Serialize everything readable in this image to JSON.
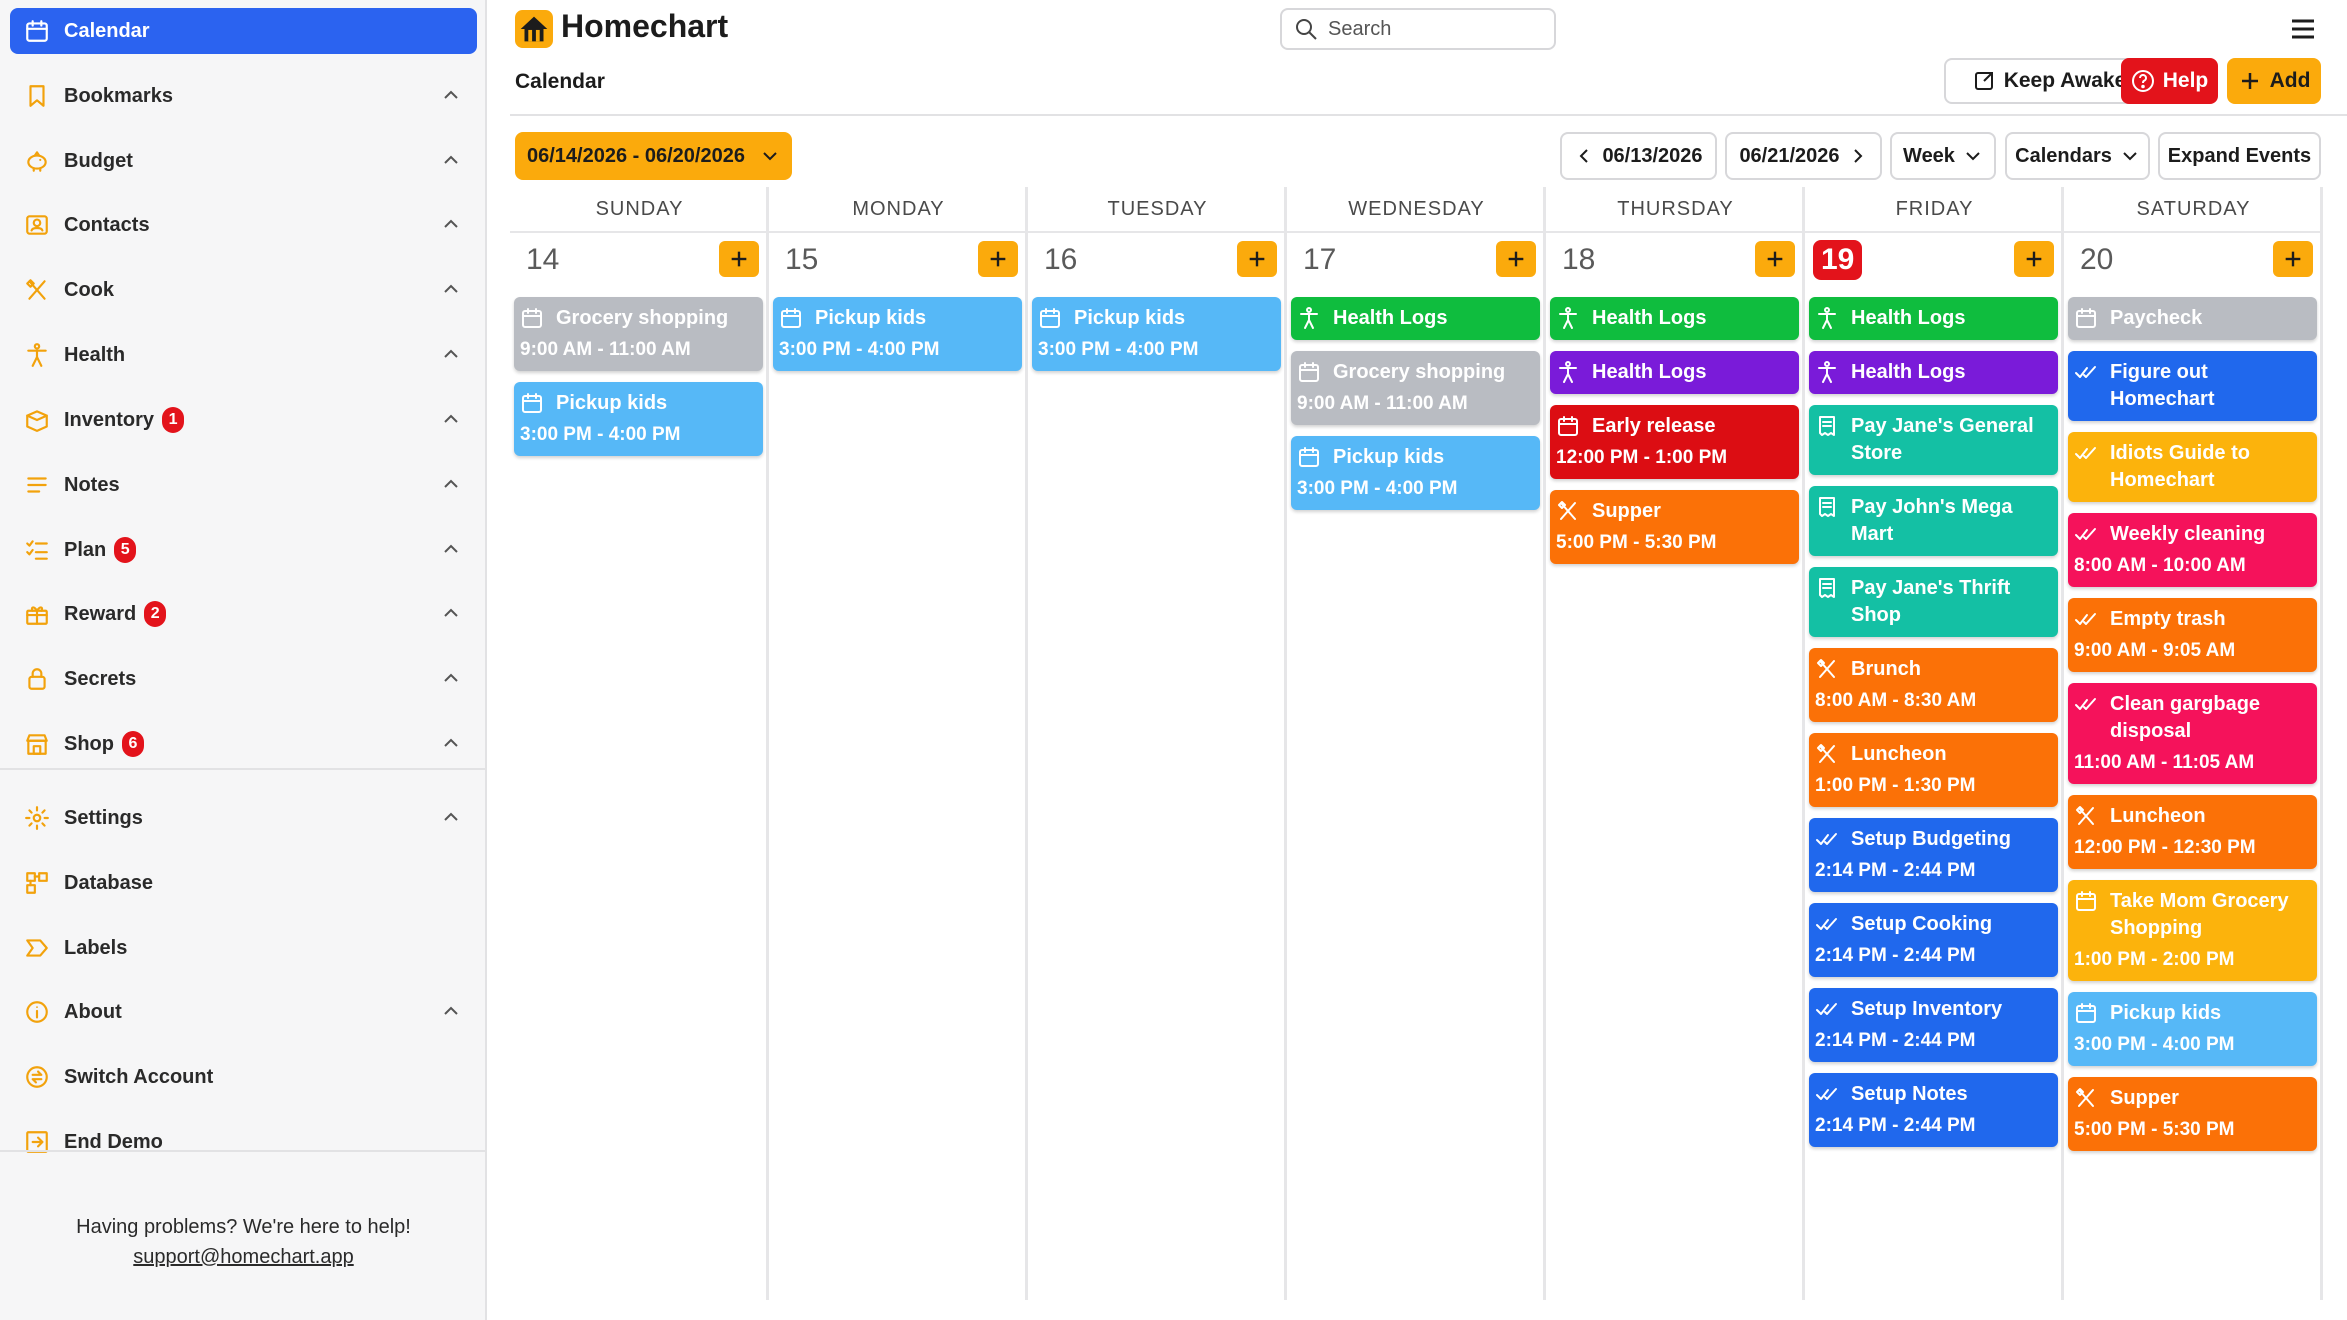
{
  "colors": {
    "accent_blue": "#2b63f0",
    "accent_orange": "#fbaa0c",
    "accent_red": "#e3131b",
    "event_gray": "#b9bcc2",
    "event_sky": "#56b8f7",
    "event_green": "#0fbd3e",
    "event_purple": "#7a1bd9",
    "event_red": "#dc0d13",
    "event_orange": "#fb7107",
    "event_teal": "#14c0a4",
    "event_blue": "#2068ed",
    "event_yellow": "#fcb30c",
    "event_pink": "#f5125b"
  },
  "app": {
    "title": "Homechart",
    "logo_icon": "house-icon"
  },
  "search": {
    "placeholder": "Search",
    "icon": "search-icon"
  },
  "page_title": "Calendar",
  "header_buttons": {
    "keep_awake": "Keep Awake",
    "help": "Help",
    "add": "Add"
  },
  "sidebar": {
    "items": [
      {
        "label": "Calendar",
        "icon": "calendar-icon",
        "active": true,
        "expandable": false,
        "badge": ""
      },
      {
        "label": "Bookmarks",
        "icon": "bookmark-icon",
        "active": false,
        "expandable": true,
        "badge": ""
      },
      {
        "label": "Budget",
        "icon": "piggy-bank-icon",
        "active": false,
        "expandable": true,
        "badge": ""
      },
      {
        "label": "Contacts",
        "icon": "contacts-icon",
        "active": false,
        "expandable": true,
        "badge": ""
      },
      {
        "label": "Cook",
        "icon": "utensils-icon",
        "active": false,
        "expandable": true,
        "badge": ""
      },
      {
        "label": "Health",
        "icon": "person-icon",
        "active": false,
        "expandable": true,
        "badge": ""
      },
      {
        "label": "Inventory",
        "icon": "box-icon",
        "active": false,
        "expandable": true,
        "badge": "1"
      },
      {
        "label": "Notes",
        "icon": "notes-icon",
        "active": false,
        "expandable": true,
        "badge": ""
      },
      {
        "label": "Plan",
        "icon": "checklist-icon",
        "active": false,
        "expandable": true,
        "badge": "5"
      },
      {
        "label": "Reward",
        "icon": "gift-icon",
        "active": false,
        "expandable": true,
        "badge": "2"
      },
      {
        "label": "Secrets",
        "icon": "lock-icon",
        "active": false,
        "expandable": true,
        "badge": ""
      },
      {
        "label": "Shop",
        "icon": "store-icon",
        "active": false,
        "expandable": true,
        "badge": "6"
      },
      {
        "label": "Settings",
        "icon": "gear-icon",
        "active": false,
        "expandable": true,
        "badge": ""
      },
      {
        "label": "Database",
        "icon": "database-icon",
        "active": false,
        "expandable": false,
        "badge": ""
      },
      {
        "label": "Labels",
        "icon": "label-icon",
        "active": false,
        "expandable": false,
        "badge": ""
      },
      {
        "label": "About",
        "icon": "info-icon",
        "active": false,
        "expandable": true,
        "badge": ""
      },
      {
        "label": "Switch Account",
        "icon": "switch-account-icon",
        "active": false,
        "expandable": false,
        "badge": ""
      },
      {
        "label": "End Demo",
        "icon": "exit-icon",
        "active": false,
        "expandable": false,
        "badge": ""
      }
    ],
    "help_text": "Having problems? We're here to help!",
    "support_email": "support@homechart.app"
  },
  "toolbar": {
    "date_range": "06/14/2026 - 06/20/2026",
    "prev_week": "06/13/2026",
    "next_week": "06/21/2026",
    "view": "Week",
    "calendars": "Calendars",
    "expand": "Expand Events"
  },
  "week": {
    "days": [
      {
        "name": "SUNDAY",
        "number": "14",
        "today": false,
        "events": [
          {
            "title": "Grocery shopping",
            "time": "9:00 AM - 11:00 AM",
            "color": "#b9bcc2",
            "icon": "calendar-icon",
            "lines": 1
          },
          {
            "title": "Pickup kids",
            "time": "3:00 PM - 4:00 PM",
            "color": "#56b8f7",
            "icon": "calendar-icon",
            "lines": 1
          }
        ]
      },
      {
        "name": "MONDAY",
        "number": "15",
        "today": false,
        "events": [
          {
            "title": "Pickup kids",
            "time": "3:00 PM - 4:00 PM",
            "color": "#56b8f7",
            "icon": "calendar-icon",
            "lines": 1
          }
        ]
      },
      {
        "name": "TUESDAY",
        "number": "16",
        "today": false,
        "events": [
          {
            "title": "Pickup kids",
            "time": "3:00 PM - 4:00 PM",
            "color": "#56b8f7",
            "icon": "calendar-icon",
            "lines": 1
          }
        ]
      },
      {
        "name": "WEDNESDAY",
        "number": "17",
        "today": false,
        "events": [
          {
            "title": "Health Logs",
            "time": "",
            "color": "#0fbd3e",
            "icon": "person-icon",
            "lines": 1
          },
          {
            "title": "Grocery shopping",
            "time": "9:00 AM - 11:00 AM",
            "color": "#b9bcc2",
            "icon": "calendar-icon",
            "lines": 1
          },
          {
            "title": "Pickup kids",
            "time": "3:00 PM - 4:00 PM",
            "color": "#56b8f7",
            "icon": "calendar-icon",
            "lines": 1
          }
        ]
      },
      {
        "name": "THURSDAY",
        "number": "18",
        "today": false,
        "events": [
          {
            "title": "Health Logs",
            "time": "",
            "color": "#0fbd3e",
            "icon": "person-icon",
            "lines": 1
          },
          {
            "title": "Health Logs",
            "time": "",
            "color": "#7a1bd9",
            "icon": "person-icon",
            "lines": 1
          },
          {
            "title": "Early release",
            "time": "12:00 PM - 1:00 PM",
            "color": "#dc0d13",
            "icon": "calendar-icon",
            "lines": 1
          },
          {
            "title": "Supper",
            "time": "5:00 PM - 5:30 PM",
            "color": "#fb7107",
            "icon": "utensils-icon",
            "lines": 1
          }
        ]
      },
      {
        "name": "FRIDAY",
        "number": "19",
        "today": true,
        "events": [
          {
            "title": "Health Logs",
            "time": "",
            "color": "#0fbd3e",
            "icon": "person-icon",
            "lines": 1
          },
          {
            "title": "Health Logs",
            "time": "",
            "color": "#7a1bd9",
            "icon": "person-icon",
            "lines": 1
          },
          {
            "title": "Pay Jane's General Store",
            "time": "",
            "color": "#14c0a4",
            "icon": "receipt-icon",
            "lines": 2
          },
          {
            "title": "Pay John's Mega Mart",
            "time": "",
            "color": "#14c0a4",
            "icon": "receipt-icon",
            "lines": 2
          },
          {
            "title": "Pay Jane's Thrift Shop",
            "time": "",
            "color": "#14c0a4",
            "icon": "receipt-icon",
            "lines": 2
          },
          {
            "title": "Brunch",
            "time": "8:00 AM - 8:30 AM",
            "color": "#fb7107",
            "icon": "utensils-icon",
            "lines": 1
          },
          {
            "title": "Luncheon",
            "time": "1:00 PM - 1:30 PM",
            "color": "#fb7107",
            "icon": "utensils-icon",
            "lines": 1
          },
          {
            "title": "Setup Budgeting",
            "time": "2:14 PM - 2:44 PM",
            "color": "#2068ed",
            "icon": "checkmarks-icon",
            "lines": 1
          },
          {
            "title": "Setup Cooking",
            "time": "2:14 PM - 2:44 PM",
            "color": "#2068ed",
            "icon": "checkmarks-icon",
            "lines": 1
          },
          {
            "title": "Setup Inventory",
            "time": "2:14 PM - 2:44 PM",
            "color": "#2068ed",
            "icon": "checkmarks-icon",
            "lines": 1
          },
          {
            "title": "Setup Notes",
            "time": "2:14 PM - 2:44 PM",
            "color": "#2068ed",
            "icon": "checkmarks-icon",
            "lines": 1
          }
        ]
      },
      {
        "name": "SATURDAY",
        "number": "20",
        "today": false,
        "events": [
          {
            "title": "Paycheck",
            "time": "",
            "color": "#b9bcc2",
            "icon": "calendar-icon",
            "lines": 1
          },
          {
            "title": "Figure out Homechart",
            "time": "",
            "color": "#2068ed",
            "icon": "checkmarks-icon",
            "lines": 2
          },
          {
            "title": "Idiots Guide to Homechart",
            "time": "",
            "color": "#fcb30c",
            "icon": "checkmarks-icon",
            "lines": 2
          },
          {
            "title": "Weekly cleaning",
            "time": "8:00 AM - 10:00 AM",
            "color": "#f5125b",
            "icon": "checkmarks-icon",
            "lines": 1
          },
          {
            "title": "Empty trash",
            "time": "9:00 AM - 9:05 AM",
            "color": "#fb7107",
            "icon": "checkmarks-icon",
            "lines": 1
          },
          {
            "title": "Clean gargbage disposal",
            "time": "11:00 AM - 11:05 AM",
            "color": "#f5125b",
            "icon": "checkmarks-icon",
            "lines": 2
          },
          {
            "title": "Luncheon",
            "time": "12:00 PM - 12:30 PM",
            "color": "#fb7107",
            "icon": "utensils-icon",
            "lines": 1
          },
          {
            "title": "Take Mom Grocery Shopping",
            "time": "1:00 PM - 2:00 PM",
            "color": "#fcb30c",
            "icon": "calendar-icon",
            "lines": 2
          },
          {
            "title": "Pickup kids",
            "time": "3:00 PM - 4:00 PM",
            "color": "#56b8f7",
            "icon": "calendar-icon",
            "lines": 1
          },
          {
            "title": "Supper",
            "time": "5:00 PM - 5:30 PM",
            "color": "#fb7107",
            "icon": "utensils-icon",
            "lines": 1
          }
        ]
      }
    ]
  }
}
